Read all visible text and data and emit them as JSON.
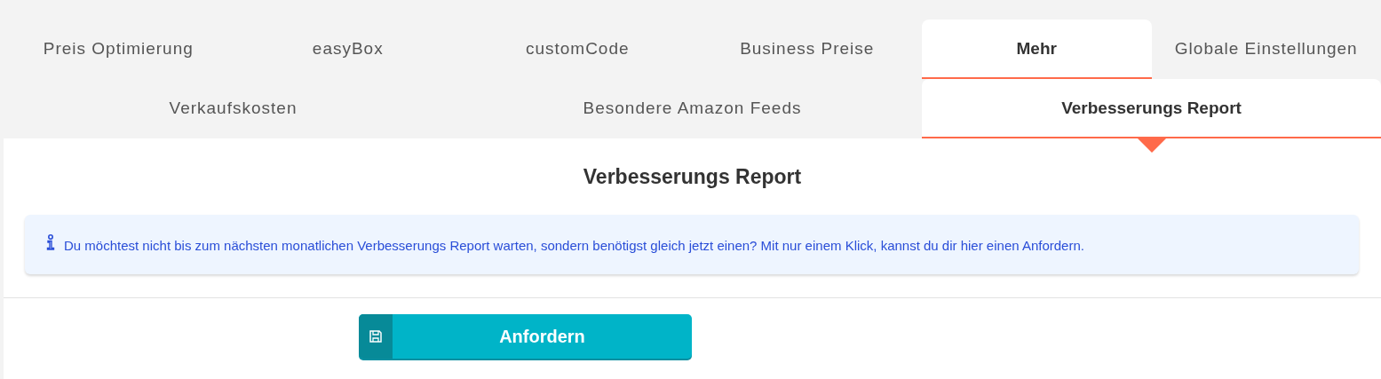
{
  "tab_rows": [
    {
      "tabs": [
        {
          "label": "Preis Optimierung",
          "selected": false
        },
        {
          "label": "easyBox",
          "selected": false
        },
        {
          "label": "customCode",
          "selected": false
        },
        {
          "label": "Business Preise",
          "selected": false
        },
        {
          "label": "Mehr",
          "selected": true
        },
        {
          "label": "Globale Einstellungen",
          "selected": false
        }
      ]
    },
    {
      "tabs": [
        {
          "label": "Verkaufskosten",
          "selected": false
        },
        {
          "label": "Besondere Amazon Feeds",
          "selected": false
        },
        {
          "label": "Verbesserungs Report",
          "selected": true
        }
      ]
    }
  ],
  "panel": {
    "title": "Verbesserungs Report",
    "info": "Du möchtest nicht bis zum nächsten monatlichen Verbesserungs Report warten, sondern benötigst gleich jetzt einen? Mit nur einem Klick, kannst du dir hier einen Anfordern.",
    "button": "Anfordern"
  }
}
